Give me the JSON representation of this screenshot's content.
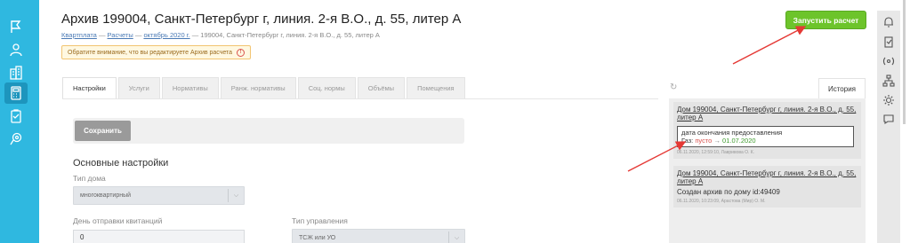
{
  "header": {
    "title": "Архив 199004, Санкт-Петербург г, линия. 2-я В.О., д. 55, литер А",
    "breadcrumb": [
      {
        "label": "Квартплата"
      },
      {
        "label": "Расчеты"
      },
      {
        "label": "октябрь 2020 г."
      },
      {
        "label": "199004, Санкт-Петербург г, линия. 2-я В.О., д. 55, литер А"
      }
    ],
    "breadcrumb_sep": " — ",
    "warning": "Обратите внимание, что вы редактируете Архив расчета",
    "run_button": "Запустить расчет"
  },
  "tabs": [
    {
      "label": "Настройки",
      "active": true
    },
    {
      "label": "Услуги"
    },
    {
      "label": "Нормативы"
    },
    {
      "label": "Ранж. нормативы"
    },
    {
      "label": "Соц. нормы"
    },
    {
      "label": "Объёмы"
    },
    {
      "label": "Помещения"
    }
  ],
  "settings": {
    "save_button": "Сохранить",
    "section_title": "Основные настройки",
    "house_type_label": "Тип дома",
    "house_type_value": "многоквартирный",
    "send_day_label": "День отправки квитанций",
    "send_day_value": "0",
    "management_label": "Тип управления",
    "management_value": "ТСЖ или УО"
  },
  "history": {
    "tab_label": "История",
    "refresh_icon": "refresh-icon",
    "entries": [
      {
        "title": "Дом 199004, Санкт-Петербург г, линия. 2-я В.О., д. 55, литер А",
        "field": "дата окончания предоставления",
        "field_prefix": "Газ:",
        "old_value": "пусто",
        "arrow": "→",
        "new_value": "01.07.2020",
        "meta": "06.11.2020, 12:59:10, Лавривова О. К."
      },
      {
        "title": "Дом 199004, Санкт-Петербург г, линия. 2-я В.О., д. 55, литер А",
        "body": "Создан архив по дому id:49409",
        "meta": "06.11.2020, 10:23:09, Арастова (Мир) О. М."
      }
    ]
  },
  "colors": {
    "sidebar": "#2fb8e0",
    "run_button": "#6dc42b",
    "annotation_arrow": "#e53935"
  }
}
